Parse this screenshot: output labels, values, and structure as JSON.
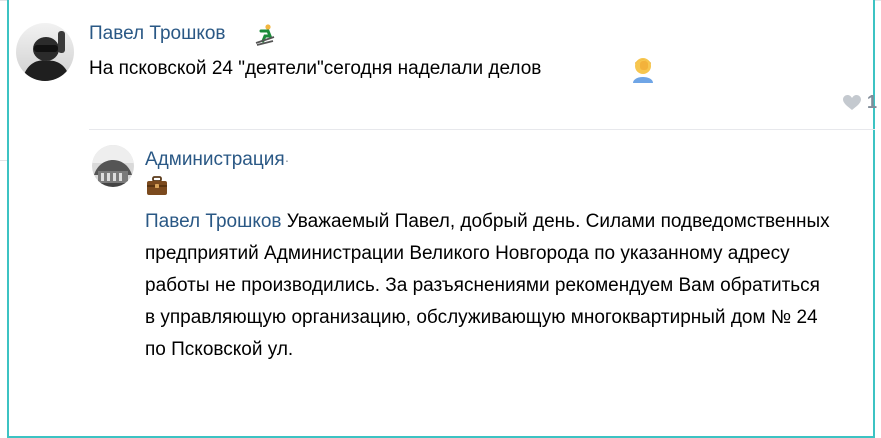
{
  "comment": {
    "author": "Павел Трошков",
    "author_badge_icon": "skier-icon",
    "text": "На псковской 24 \"деятели\"сегодня наделали делов",
    "trailing_emoji_icon": "person-facepalm-icon",
    "likes": {
      "icon": "heart-icon",
      "count": "1"
    }
  },
  "reply": {
    "author": "Администрация",
    "author_suffix": "·",
    "badge_icon": "briefcase-icon",
    "mention": "Павел Трошков",
    "text": " Уважаемый Павел, добрый день. Силами подведомственных предприятий Администрации Великого Новгорода по указанному адресу работы не производились. За разъяснениями рекомендуем Вам обратиться в управляющую организацию, обслуживающую многоквартирный дом № 24 по Псковской ул."
  },
  "colors": {
    "link": "#2a5885",
    "frame": "#3cc3c3",
    "muted": "#818c99"
  }
}
